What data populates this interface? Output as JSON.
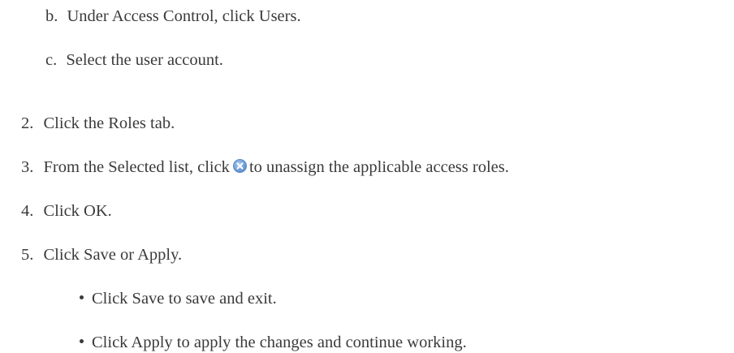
{
  "steps": {
    "sub_b": {
      "marker": "b.",
      "text": "Under Access Control, click Users."
    },
    "sub_c": {
      "marker": "c.",
      "text": "Select the user account."
    },
    "step2": {
      "marker": "2.",
      "text": "Click the Roles tab."
    },
    "step3": {
      "marker": "3.",
      "text_before": "From the Selected list, click",
      "text_after": "to unassign the applicable access roles.",
      "icon": "remove-circle-x-icon"
    },
    "step4": {
      "marker": "4.",
      "text": "Click OK."
    },
    "step5": {
      "marker": "5.",
      "text": "Click Save or Apply."
    },
    "bullets": [
      "Click Save to save and exit.",
      "Click Apply to apply the changes and continue working."
    ]
  }
}
